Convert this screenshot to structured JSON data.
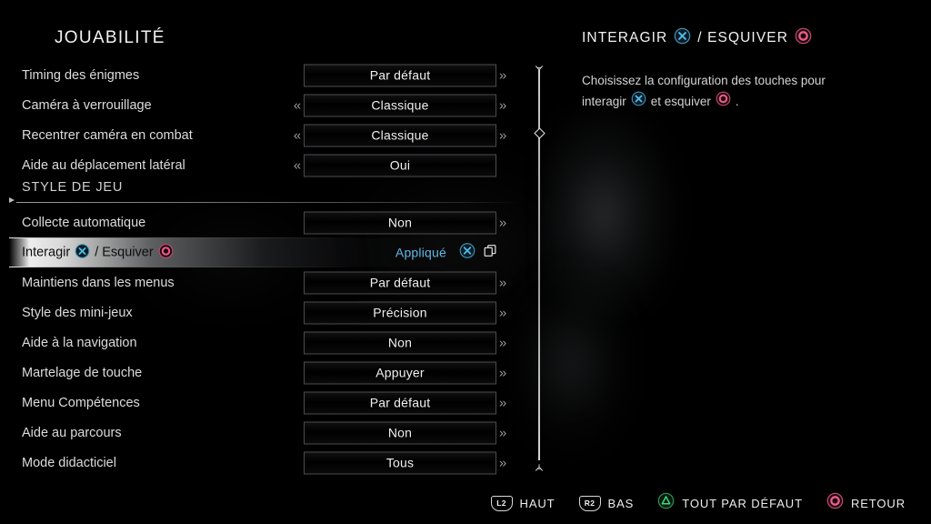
{
  "colors": {
    "accent_blue": "#5fb8e6",
    "cross_blue": "#3aa5d8",
    "circle_red": "#e8527a",
    "triangle_green": "#35c46a",
    "text": "#e8e8e8",
    "box_border": "#4c4c4c",
    "highlight": "#fafafa"
  },
  "left_panel": {
    "title": "JOUABILITÉ",
    "rows": [
      {
        "type": "option",
        "label": "Timing des énigmes",
        "value": "Par défaut",
        "left_arrow": false,
        "right_arrow": true
      },
      {
        "type": "option",
        "label": "Caméra à verrouillage",
        "value": "Classique",
        "left_arrow": true,
        "right_arrow": true
      },
      {
        "type": "option",
        "label": "Recentrer caméra en combat",
        "value": "Classique",
        "left_arrow": true,
        "right_arrow": true
      },
      {
        "type": "option",
        "label": "Aide au déplacement latéral",
        "value": "Oui",
        "left_arrow": true,
        "right_arrow": false
      },
      {
        "type": "section",
        "label": "STYLE DE JEU"
      },
      {
        "type": "option",
        "label": "Collecte automatique",
        "value": "Non",
        "left_arrow": false,
        "right_arrow": true
      },
      {
        "type": "selected",
        "label_parts": [
          "Interagir",
          "cross-icon",
          "/ Esquiver",
          "circle-icon"
        ],
        "label_text": "Interagir  / Esquiver ",
        "status": "Appliqué",
        "icons": [
          "cross-icon",
          "copy-icon"
        ]
      },
      {
        "type": "option",
        "label": "Maintiens dans les menus",
        "value": "Par défaut",
        "left_arrow": false,
        "right_arrow": true
      },
      {
        "type": "option",
        "label": "Style des mini-jeux",
        "value": "Précision",
        "left_arrow": false,
        "right_arrow": true
      },
      {
        "type": "option",
        "label": "Aide à la navigation",
        "value": "Non",
        "left_arrow": false,
        "right_arrow": true
      },
      {
        "type": "option",
        "label": "Martelage de touche",
        "value": "Appuyer",
        "left_arrow": false,
        "right_arrow": true
      },
      {
        "type": "option",
        "label": "Menu Compétences",
        "value": "Par défaut",
        "left_arrow": false,
        "right_arrow": true
      },
      {
        "type": "option",
        "label": "Aide au parcours",
        "value": "Non",
        "left_arrow": false,
        "right_arrow": true
      },
      {
        "type": "option",
        "label": "Mode didacticiel",
        "value": "Tous",
        "left_arrow": false,
        "right_arrow": true
      }
    ],
    "left_chevron_glyph": "«",
    "right_chevron_glyph": "»"
  },
  "right_panel": {
    "title_part1": "INTERAGIR",
    "title_sep": "/ ESQUIVER",
    "desc_line1": "Choisissez la configuration des touches pour",
    "desc_line2_a": "interagir",
    "desc_line2_b": "et esquiver",
    "desc_line2_c": "."
  },
  "footer": {
    "hints": [
      {
        "icon": "l2-shoulder-icon",
        "icon_label": "L2",
        "label": "HAUT"
      },
      {
        "icon": "r2-shoulder-icon",
        "icon_label": "R2",
        "label": "BAS"
      },
      {
        "icon": "triangle-icon",
        "icon_label": "",
        "label": "TOUT PAR DÉFAUT"
      },
      {
        "icon": "circle-icon",
        "icon_label": "",
        "label": "RETOUR"
      }
    ]
  },
  "scrollbar": {
    "thumb_position_pct": 17
  }
}
